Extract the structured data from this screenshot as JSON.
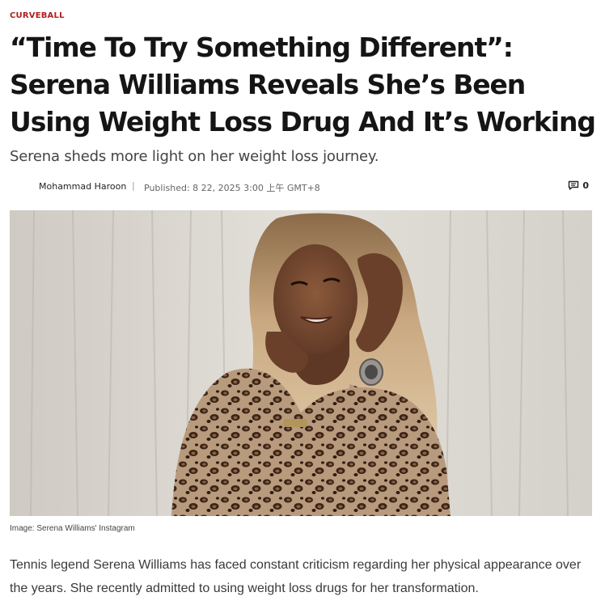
{
  "article": {
    "category": "CURVEBALL",
    "headline": "“Time To Try Something Different”: Serena Williams Reveals She’s Been Using Weight Loss Drug And It’s Working",
    "subtitle": "Serena sheds more light on her weight loss journey.",
    "author": "Mohammad Haroon",
    "separator": "|",
    "published": "Published: 8 22, 2025 3:00 上午 GMT+8",
    "comment_count": "0",
    "image_caption": "Image: Serena Williams' Instagram",
    "body": "Tennis legend Serena Williams has faced constant criticism regarding her physical appearance over the years. She recently admitted to using weight loss drugs for her transformation."
  },
  "icons": {
    "comments": "comment-bubble-icon"
  },
  "colors": {
    "category": "#b01e1e",
    "headline": "#151515",
    "body": "#3a3a3a"
  }
}
